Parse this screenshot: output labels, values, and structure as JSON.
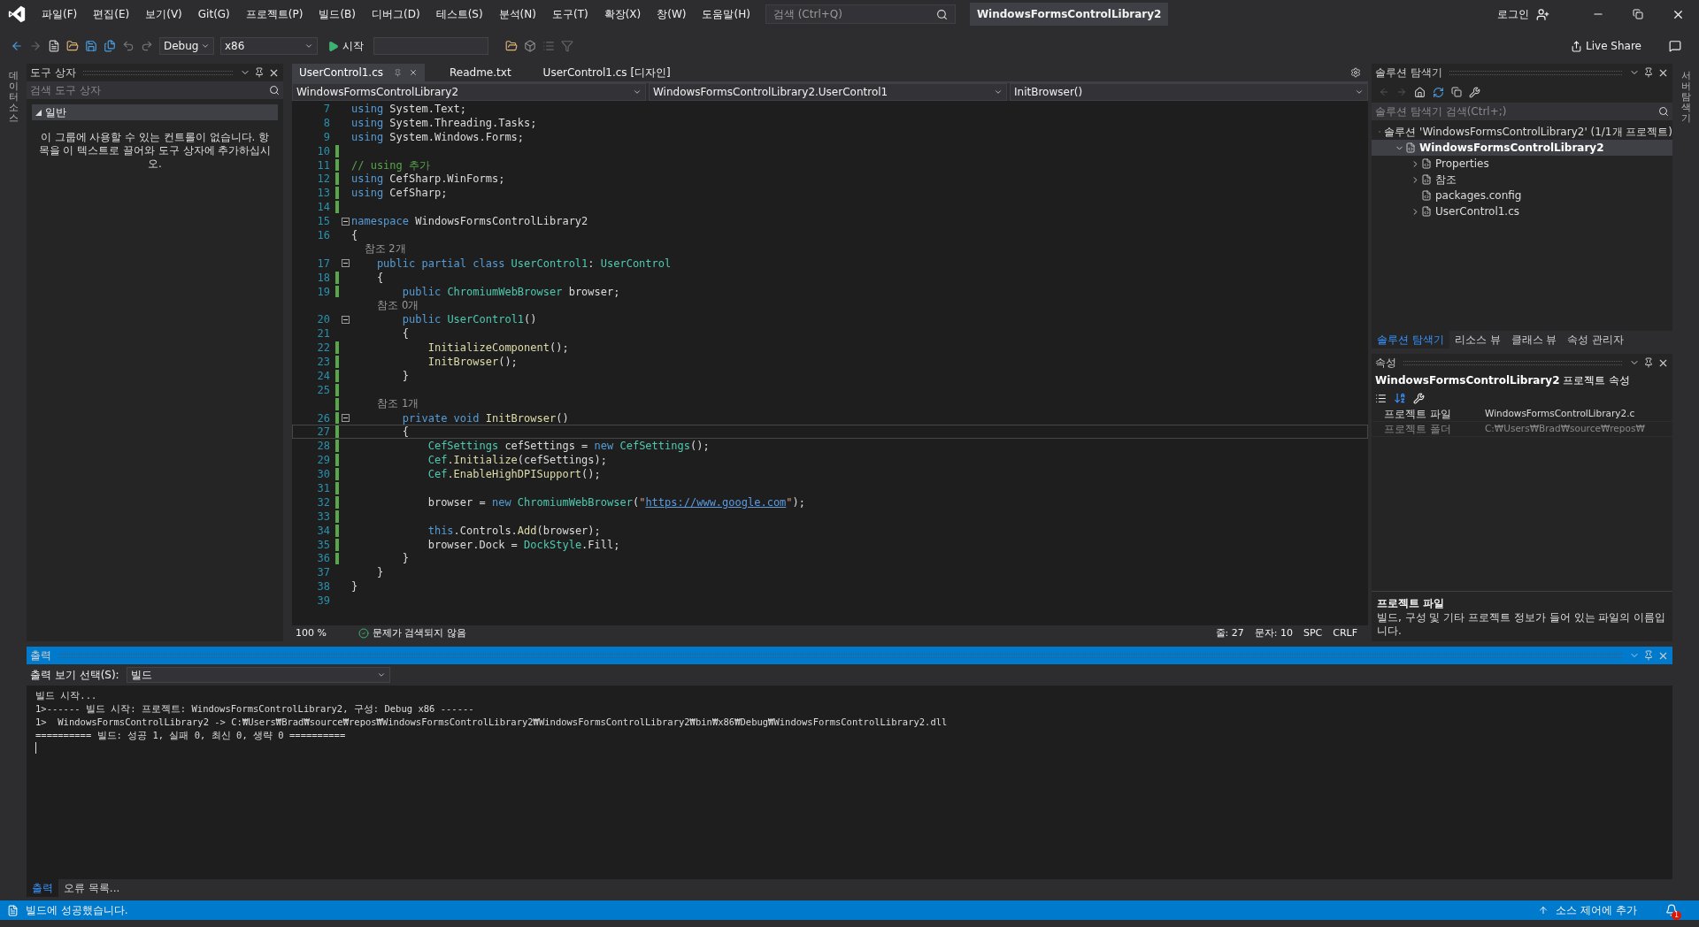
{
  "menu": [
    "파일(F)",
    "편집(E)",
    "보기(V)",
    "Git(G)",
    "프로젝트(P)",
    "빌드(B)",
    "디버그(D)",
    "테스트(S)",
    "분석(N)",
    "도구(T)",
    "확장(X)",
    "창(W)",
    "도움말(H)"
  ],
  "search": {
    "placeholder": "검색 (Ctrl+Q)"
  },
  "window": {
    "title": "WindowsFormsControlLibrary2",
    "login": "로그인"
  },
  "toolbar": {
    "configuration": "Debug",
    "platform": "x86",
    "start": "시작",
    "live_share": "Live Share"
  },
  "side_tabs": {
    "left": "데이터 소스",
    "right": "서버 탐색기"
  },
  "toolbox": {
    "title": "도구 상자",
    "placeholder": "검색 도구 상자",
    "group": {
      "label": "일반",
      "expanded": true
    },
    "message": "이 그룹에 사용할 수 있는 컨트롤이 없습니다. 항목을 이 텍스트로 끌어와 도구 상자에 추가하십시오."
  },
  "editor": {
    "tabs": [
      {
        "label": "UserControl1.cs",
        "selected": true
      },
      {
        "label": "Readme.txt",
        "selected": false
      },
      {
        "label": "UserControl1.cs [디자인]",
        "selected": false
      }
    ],
    "nav": [
      "WindowsFormsControlLibrary2",
      "WindowsFormsControlLibrary2.UserControl1",
      "InitBrowser()"
    ],
    "lines": [
      {
        "kind": "code",
        "num": "7",
        "changed": false,
        "fold": false,
        "current": false,
        "tokens": [
          {
            "kind": "kw",
            "text": "using"
          },
          {
            "kind": "plain",
            "text": " System.Text;"
          }
        ]
      },
      {
        "kind": "code",
        "num": "8",
        "changed": false,
        "fold": false,
        "current": false,
        "tokens": [
          {
            "kind": "kw",
            "text": "using"
          },
          {
            "kind": "plain",
            "text": " System.Threading.Tasks;"
          }
        ]
      },
      {
        "kind": "code",
        "num": "9",
        "changed": false,
        "fold": false,
        "current": false,
        "tokens": [
          {
            "kind": "kw",
            "text": "using"
          },
          {
            "kind": "plain",
            "text": " System.Windows.Forms;"
          }
        ]
      },
      {
        "kind": "code",
        "num": "10",
        "changed": true,
        "fold": false,
        "current": false
      },
      {
        "kind": "code",
        "num": "11",
        "changed": true,
        "fold": false,
        "current": false,
        "tokens": [
          {
            "kind": "comment",
            "text": "// using 추가"
          }
        ]
      },
      {
        "kind": "code",
        "num": "12",
        "changed": true,
        "fold": false,
        "current": false,
        "tokens": [
          {
            "kind": "kw",
            "text": "using"
          },
          {
            "kind": "plain",
            "text": " CefSharp.WinForms;"
          }
        ]
      },
      {
        "kind": "code",
        "num": "13",
        "changed": true,
        "fold": false,
        "current": false,
        "tokens": [
          {
            "kind": "kw",
            "text": "using"
          },
          {
            "kind": "plain",
            "text": " CefSharp;"
          }
        ]
      },
      {
        "kind": "code",
        "num": "14",
        "changed": true,
        "fold": false,
        "current": false
      },
      {
        "kind": "code",
        "num": "15",
        "changed": false,
        "fold": true,
        "current": false,
        "tokens": [
          {
            "kind": "kw",
            "text": "namespace"
          },
          {
            "kind": "plain",
            "text": " WindowsFormsControlLibrary2"
          }
        ]
      },
      {
        "kind": "code",
        "num": "16",
        "changed": false,
        "fold": false,
        "current": false,
        "tokens": [
          {
            "kind": "plain",
            "text": "{"
          }
        ]
      },
      {
        "kind": "lens",
        "changed": false,
        "text": "    참조 2개"
      },
      {
        "kind": "code",
        "num": "17",
        "changed": false,
        "fold": true,
        "current": false,
        "tokens": [
          {
            "kind": "kw",
            "text": "    public partial class"
          },
          {
            "kind": "type",
            "text": " UserControl1"
          },
          {
            "kind": "plain",
            "text": ": "
          },
          {
            "kind": "type",
            "text": "UserControl"
          }
        ]
      },
      {
        "kind": "code",
        "num": "18",
        "changed": true,
        "fold": false,
        "current": false,
        "tokens": [
          {
            "kind": "plain",
            "text": "    {"
          }
        ]
      },
      {
        "kind": "code",
        "num": "19",
        "changed": true,
        "fold": false,
        "current": false,
        "tokens": [
          {
            "kind": "kw",
            "text": "        public"
          },
          {
            "kind": "type",
            "text": " ChromiumWebBrowser"
          },
          {
            "kind": "plain",
            "text": " browser;"
          }
        ]
      },
      {
        "kind": "lens",
        "changed": false,
        "text": "        참조 0개"
      },
      {
        "kind": "code",
        "num": "20",
        "changed": false,
        "fold": true,
        "current": false,
        "tokens": [
          {
            "kind": "kw",
            "text": "        public"
          },
          {
            "kind": "type",
            "text": " UserControl1"
          },
          {
            "kind": "plain",
            "text": "()"
          }
        ]
      },
      {
        "kind": "code",
        "num": "21",
        "changed": false,
        "fold": false,
        "current": false,
        "tokens": [
          {
            "kind": "plain",
            "text": "        {"
          }
        ]
      },
      {
        "kind": "code",
        "num": "22",
        "changed": true,
        "fold": false,
        "current": false,
        "tokens": [
          {
            "kind": "method",
            "text": "            InitializeComponent"
          },
          {
            "kind": "plain",
            "text": "();"
          }
        ]
      },
      {
        "kind": "code",
        "num": "23",
        "changed": true,
        "fold": false,
        "current": false,
        "tokens": [
          {
            "kind": "method",
            "text": "            InitBrowser"
          },
          {
            "kind": "plain",
            "text": "();"
          }
        ]
      },
      {
        "kind": "code",
        "num": "24",
        "changed": true,
        "fold": false,
        "current": false,
        "tokens": [
          {
            "kind": "plain",
            "text": "        }"
          }
        ]
      },
      {
        "kind": "code",
        "num": "25",
        "changed": true,
        "fold": false,
        "current": false
      },
      {
        "kind": "lens",
        "changed": true,
        "text": "        참조 1개"
      },
      {
        "kind": "code",
        "num": "26",
        "changed": true,
        "fold": true,
        "current": false,
        "tokens": [
          {
            "kind": "kw",
            "text": "        private void"
          },
          {
            "kind": "method",
            "text": " InitBrowser"
          },
          {
            "kind": "plain",
            "text": "()"
          }
        ]
      },
      {
        "kind": "code",
        "num": "27",
        "changed": true,
        "fold": false,
        "current": true,
        "tokens": [
          {
            "kind": "plain",
            "text": "        {"
          }
        ]
      },
      {
        "kind": "code",
        "num": "28",
        "changed": true,
        "fold": false,
        "current": false,
        "tokens": [
          {
            "kind": "type",
            "text": "            CefSettings"
          },
          {
            "kind": "plain",
            "text": " cefSettings = "
          },
          {
            "kind": "kw",
            "text": "new"
          },
          {
            "kind": "type",
            "text": " CefSettings"
          },
          {
            "kind": "plain",
            "text": "();"
          }
        ]
      },
      {
        "kind": "code",
        "num": "29",
        "changed": true,
        "fold": false,
        "current": false,
        "tokens": [
          {
            "kind": "type",
            "text": "            Cef"
          },
          {
            "kind": "method",
            "text": ".Initialize"
          },
          {
            "kind": "plain",
            "text": "(cefSettings);"
          }
        ]
      },
      {
        "kind": "code",
        "num": "30",
        "changed": true,
        "fold": false,
        "current": false,
        "tokens": [
          {
            "kind": "type",
            "text": "            Cef"
          },
          {
            "kind": "method",
            "text": ".EnableHighDPISupport"
          },
          {
            "kind": "plain",
            "text": "();"
          }
        ]
      },
      {
        "kind": "code",
        "num": "31",
        "changed": true,
        "fold": false,
        "current": false
      },
      {
        "kind": "code",
        "num": "32",
        "changed": true,
        "fold": false,
        "current": false,
        "tokens": [
          {
            "kind": "plain",
            "text": "            browser = "
          },
          {
            "kind": "kw",
            "text": "new"
          },
          {
            "kind": "type",
            "text": " ChromiumWebBrowser"
          },
          {
            "kind": "plain",
            "text": "("
          },
          {
            "kind": "string",
            "text": "\""
          },
          {
            "kind": "link",
            "text": "https://www.google.com"
          },
          {
            "kind": "string",
            "text": "\""
          },
          {
            "kind": "plain",
            "text": ");"
          }
        ]
      },
      {
        "kind": "code",
        "num": "33",
        "changed": true,
        "fold": false,
        "current": false
      },
      {
        "kind": "code",
        "num": "34",
        "changed": true,
        "fold": false,
        "current": false,
        "tokens": [
          {
            "kind": "kw",
            "text": "            this"
          },
          {
            "kind": "plain",
            "text": ".Controls."
          },
          {
            "kind": "method",
            "text": "Add"
          },
          {
            "kind": "plain",
            "text": "(browser);"
          }
        ]
      },
      {
        "kind": "code",
        "num": "35",
        "changed": true,
        "fold": false,
        "current": false,
        "tokens": [
          {
            "kind": "plain",
            "text": "            browser.Dock = "
          },
          {
            "kind": "type",
            "text": "DockStyle"
          },
          {
            "kind": "plain",
            "text": ".Fill;"
          }
        ]
      },
      {
        "kind": "code",
        "num": "36",
        "changed": true,
        "fold": false,
        "current": false,
        "tokens": [
          {
            "kind": "plain",
            "text": "        }"
          }
        ]
      },
      {
        "kind": "code",
        "num": "37",
        "changed": false,
        "fold": false,
        "current": false,
        "tokens": [
          {
            "kind": "plain",
            "text": "    }"
          }
        ]
      },
      {
        "kind": "code",
        "num": "38",
        "changed": false,
        "fold": false,
        "current": false,
        "tokens": [
          {
            "kind": "plain",
            "text": "}"
          }
        ]
      },
      {
        "kind": "code",
        "num": "39",
        "changed": false,
        "fold": false,
        "current": false
      }
    ],
    "status": {
      "zoom": "100 %",
      "issues": "문제가 검색되지 않음",
      "line": "줄: 27",
      "col": "문자: 10",
      "spacing": "SPC",
      "eol": "CRLF"
    }
  },
  "solution_explorer": {
    "title": "솔루션 탐색기",
    "placeholder": "솔루션 탐색기 검색(Ctrl+;)",
    "tree": [
      {
        "label": "솔루션 'WindowsFormsControlLibrary2' (1/1개 프로젝트)",
        "kind": "leaf",
        "selected": false,
        "children": [
          {
            "label": "WindowsFormsControlLibrary2",
            "kind": "node",
            "expanded": true,
            "selected": true,
            "children": [
              {
                "label": "Properties",
                "kind": "node",
                "expanded": false,
                "selected": false
              },
              {
                "label": "참조",
                "kind": "node",
                "expanded": false,
                "selected": false
              },
              {
                "label": "packages.config",
                "kind": "leaf",
                "selected": false
              },
              {
                "label": "UserControl1.cs",
                "kind": "node",
                "expanded": false,
                "selected": false
              }
            ]
          }
        ]
      }
    ],
    "tabs": [
      {
        "label": "솔루션 탐색기",
        "selected": true
      },
      {
        "label": "리소스 뷰",
        "selected": false
      },
      {
        "label": "클래스 뷰",
        "selected": false
      },
      {
        "label": "속성 관리자",
        "selected": false
      }
    ]
  },
  "properties": {
    "title": "속성",
    "object": "**WindowsFormsControlLibrary2** 프로젝트 속성",
    "rows": [
      {
        "name": "프로젝트 파일",
        "value": "WindowsFormsControlLibrary2.c",
        "disabled": false
      },
      {
        "name": "프로젝트 폴더",
        "value": "C:₩Users₩Brad₩source₩repos₩",
        "disabled": true
      }
    ],
    "description": {
      "title": "프로젝트 파일",
      "text": "빌드, 구성 및 기타 프로젝트 정보가 들어 있는 파일의 이름입니다."
    }
  },
  "output": {
    "title": "출력",
    "source_label": "출력 보기 선택(S):",
    "source": "빌드",
    "lines": [
      "빌드 시작...",
      "1>------ 빌드 시작: 프로젝트: WindowsFormsControlLibrary2, 구성: Debug x86 ------",
      "1>  WindowsFormsControlLibrary2 -> C:₩Users₩Brad₩source₩repos₩WindowsFormsControlLibrary2₩WindowsFormsControlLibrary2₩bin₩x86₩Debug₩WindowsFormsControlLibrary2.dll",
      "========== 빌드: 성공 1, 실패 0, 최신 0, 생략 0 =========="
    ],
    "tabs": [
      {
        "label": "출력",
        "selected": true
      },
      {
        "label": "오류 목록...",
        "selected": false
      }
    ]
  },
  "status_bar": {
    "message": "빌드에 성공했습니다.",
    "source_control": "소스 제어에 추가",
    "notifications": "1"
  }
}
